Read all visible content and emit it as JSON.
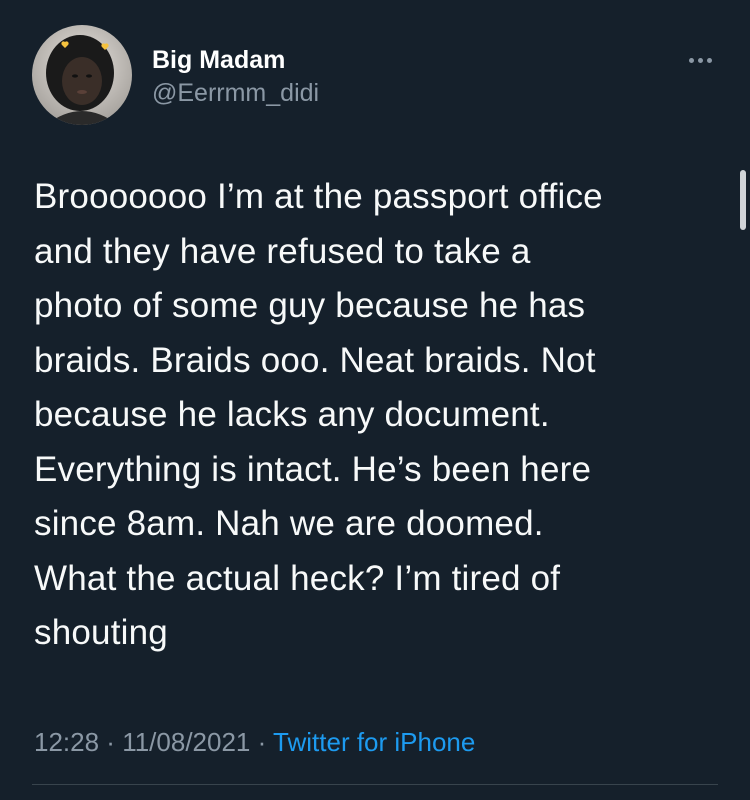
{
  "user": {
    "display_name": "Big Madam",
    "handle": "@Eerrmm_didi",
    "avatar_icon": "profile-avatar"
  },
  "menu": {
    "more_icon": "more-horizontal-icon"
  },
  "tweet": {
    "lines": [
      "Brooooooo I’m at the passport office",
      "and they have refused to take a",
      "photo of some guy because he has",
      "braids. Braids ooo. Neat braids. Not",
      "because he lacks any document.",
      "Everything is intact. He’s been here",
      "since 8am. Nah we are doomed.",
      "What the actual heck? I’m tired of",
      "shouting"
    ]
  },
  "meta": {
    "time": "12:28",
    "separator_1": " · ",
    "date": "11/08/2021",
    "separator_2": " · ",
    "source": "Twitter for iPhone"
  },
  "colors": {
    "background": "#15202b",
    "text": "#f7f9f9",
    "secondary": "#8b98a5",
    "link": "#1d9bf0",
    "divider": "#38444d"
  }
}
